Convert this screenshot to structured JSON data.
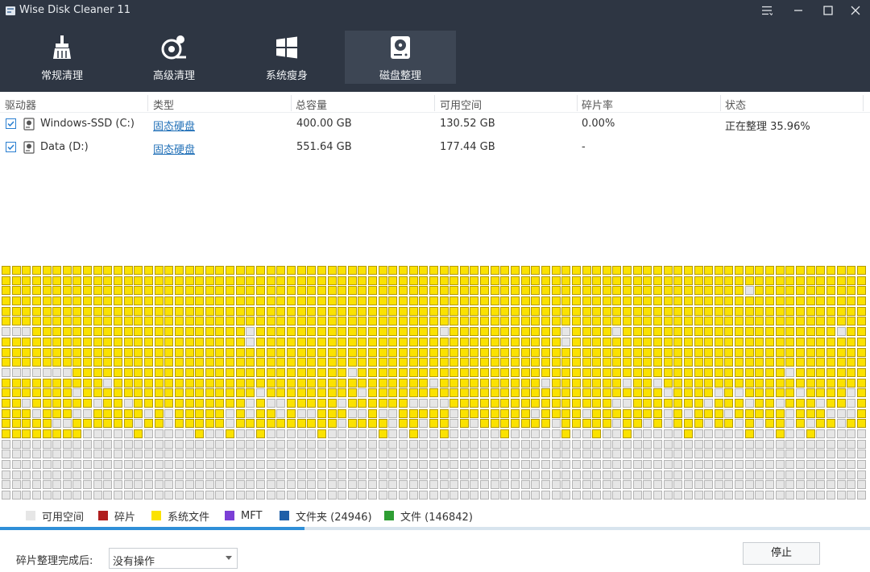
{
  "window": {
    "title": "Wise Disk Cleaner 11",
    "controls": [
      "menu-icon",
      "minimize-icon",
      "maximize-icon",
      "close-icon"
    ]
  },
  "toolbar": {
    "tabs": [
      {
        "label": "常规清理",
        "icon": "broom-icon",
        "active": false
      },
      {
        "label": "高级清理",
        "icon": "advanced-clean-icon",
        "active": false
      },
      {
        "label": "系统瘦身",
        "icon": "windows-icon",
        "active": false
      },
      {
        "label": "磁盘整理",
        "icon": "disk-defrag-icon",
        "active": true
      }
    ]
  },
  "drive_table": {
    "columns": [
      "驱动器",
      "类型",
      "总容量",
      "可用空间",
      "碎片率",
      "状态"
    ],
    "rows": [
      {
        "checked": true,
        "drive": "Windows-SSD (C:)",
        "type": "固态硬盘",
        "total": "400.00 GB",
        "free": "130.52 GB",
        "fragmentation": "0.00%",
        "status": "正在整理 35.96%"
      },
      {
        "checked": true,
        "drive": "Data (D:)",
        "type": "固态硬盘",
        "total": "551.64 GB",
        "free": "177.44 GB",
        "fragmentation": "-",
        "status": ""
      }
    ]
  },
  "legend": {
    "items": [
      {
        "label": "可用空间",
        "color": "#e6e6e6"
      },
      {
        "label": "碎片",
        "color": "#b01e1e"
      },
      {
        "label": "系统文件",
        "color": "#fbe200"
      },
      {
        "label": "MFT",
        "color": "#7b3fd6"
      },
      {
        "label": "文件夹 (24946)",
        "color": "#1f5fa8"
      },
      {
        "label": "文件 (146842)",
        "color": "#2e9e33"
      }
    ]
  },
  "progress": {
    "value_percent": 35,
    "color": "#2f8fd8"
  },
  "after_defrag": {
    "label": "碎片整理完成后:",
    "selected_option": "没有操作"
  },
  "stop_button": {
    "label": "停止"
  },
  "colors": {
    "topbar": "#2e3643",
    "active_tab": "#3d4654",
    "system_block": "#fbe200",
    "free_block": "#e6e6e6"
  }
}
